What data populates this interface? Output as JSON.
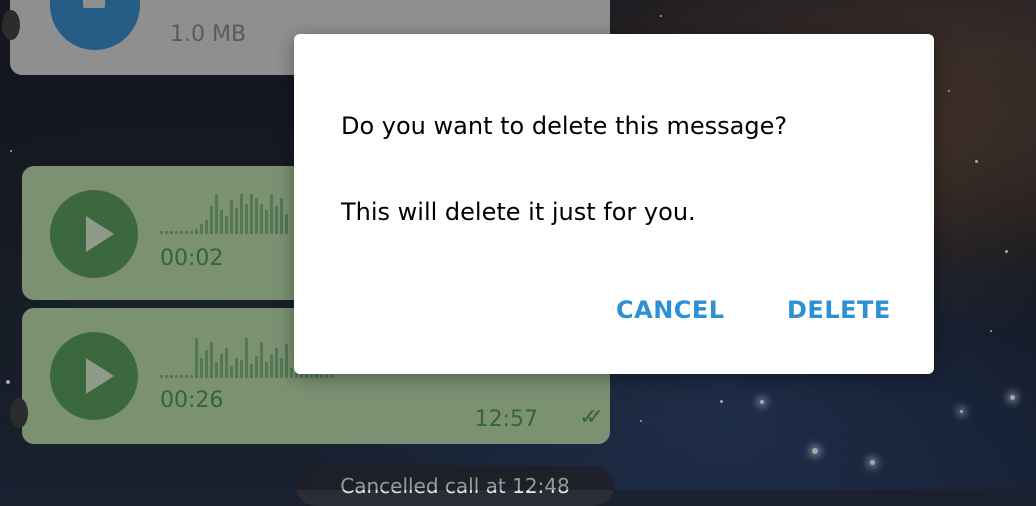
{
  "chat": {
    "file_message": {
      "size": "1.0 MB",
      "icon": "file-icon"
    },
    "voice_messages": [
      {
        "duration": "00:02"
      },
      {
        "duration": "00:26",
        "time": "12:57",
        "status_icon": "double-check-icon"
      }
    ],
    "service_message": "Cancelled call at 12:48",
    "colors": {
      "voice_bubble": "#bfdfb0",
      "voice_accent": "#5ba05c",
      "file_icon": "#3a8fd0"
    }
  },
  "dialog": {
    "title": "Do you want to delete this message?",
    "description": "This will delete it just for you.",
    "cancel_label": "CANCEL",
    "delete_label": "DELETE",
    "accent_color": "#2d8fd5"
  }
}
